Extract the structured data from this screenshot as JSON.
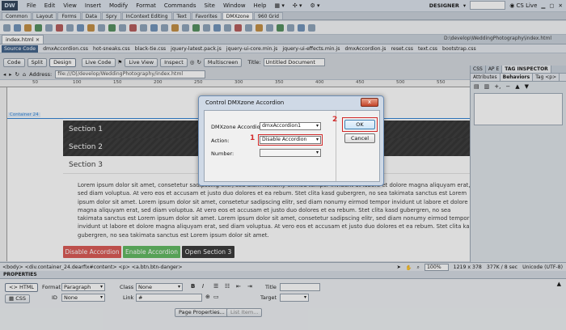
{
  "app": {
    "logo": "DW",
    "workspace": "DESIGNER",
    "cs_live": "CS Live"
  },
  "menu": [
    "File",
    "Edit",
    "View",
    "Insert",
    "Modify",
    "Format",
    "Commands",
    "Site",
    "Window",
    "Help"
  ],
  "insert_tabs": [
    "Common",
    "Layout",
    "Forms",
    "Data",
    "Spry",
    "InContext Editing",
    "Text",
    "Favorites",
    "DMXzone",
    "960 Grid"
  ],
  "insert_tabs_active": 8,
  "document": {
    "file_tab": "index.html",
    "path": "D:\\develop\\WeddingPhotography\\index.html"
  },
  "related_files": [
    "Source Code",
    "dmxAccordion.css",
    "hot-sneaks.css",
    "black-tie.css",
    "jquery-latest.pack.js",
    "jquery-ui-core.min.js",
    "jquery-ui-effects.min.js",
    "dmxAccordion.js",
    "reset.css",
    "text.css",
    "bootstrap.css"
  ],
  "toolbar": {
    "code": "Code",
    "split": "Split",
    "design": "Design",
    "live_code": "Live Code",
    "live_view": "Live View",
    "inspect": "Inspect",
    "multiscreen": "Multiscreen",
    "title_label": "Title:",
    "title_value": "Untitled Document"
  },
  "address": {
    "label": "Address:",
    "value": "file:///D|/develop/WeddingPhotography/index.html"
  },
  "ruler_marks": [
    "50",
    "100",
    "150",
    "200",
    "250",
    "300",
    "350",
    "400",
    "450",
    "500",
    "550"
  ],
  "canvas": {
    "container_label": "Container 24",
    "sections": [
      "Section 1",
      "Section 2",
      "Section 3"
    ],
    "lorem": "Lorem ipsum dolor sit amet, consetetur sadipscing elitr, sed diam nonumy eirmod tempor invidunt ut labore et dolore magna aliquyam erat, sed diam voluptua. At vero eos et accusam et justo duo dolores et ea rebum. Stet clita kasd gubergren, no sea takimata sanctus est Lorem ipsum dolor sit amet. Lorem ipsum dolor sit amet, consetetur sadipscing elitr, sed diam nonumy eirmod tempor invidunt ut labore et dolore magna aliquyam erat, sed diam voluptua. At vero eos et accusam et justo duo dolores et ea rebum. Stet clita kasd gubergren, no sea takimata sanctus est Lorem ipsum dolor sit amet. Lorem ipsum dolor sit amet, consetetur sadipscing elitr, sed diam nonumy eirmod tempor invidunt ut labore et dolore magna aliquyam erat, sed diam voluptua. At vero eos et accusam et justo duo dolores et ea rebum. Stet clita kasd gubergren, no sea takimata sanctus est Lorem ipsum dolor sit amet.",
    "buttons": [
      {
        "label": "Disable Accordion",
        "color": "#d9534f"
      },
      {
        "label": "Enable Accordion",
        "color": "#5cb85c"
      },
      {
        "label": "Open Section 3",
        "color": "#333333"
      }
    ]
  },
  "status": {
    "tags": "<body> <div.container_24.dearfix#content> <p> <a.btn.btn-danger>",
    "zoom": "100%",
    "size": "1219 x 378",
    "weight": "377K / 8 sec",
    "encoding": "Unicode (UTF-8)"
  },
  "properties": {
    "header": "PROPERTIES",
    "html": "HTML",
    "css": "CSS",
    "format_label": "Format",
    "format_value": "Paragraph",
    "class_label": "Class",
    "class_value": "None",
    "id_label": "ID",
    "id_value": "None",
    "link_label": "Link",
    "link_value": "#",
    "title_label": "Title",
    "target_label": "Target",
    "bold": "B",
    "italic": "I",
    "page_properties": "Page Properties...",
    "list_item": "List Item..."
  },
  "right_panel": {
    "tabs": [
      "CSS",
      "AP E",
      "TAG INSPECTOR"
    ],
    "subtabs": [
      "Attributes",
      "Behaviors",
      "Tag <p>"
    ],
    "add": "+,",
    "remove": "−"
  },
  "dialog": {
    "title": "Control DMXzone Accordion",
    "close": "x",
    "accordion_label": "DMXzone Accordion:",
    "accordion_value": "dmxAccordion1",
    "action_label": "Action:",
    "action_value": "Disable Accordion",
    "number_label": "Number:",
    "ok": "OK",
    "cancel": "Cancel",
    "step1": "1",
    "step2": "2",
    "highlight_color": "#d22a2a"
  }
}
